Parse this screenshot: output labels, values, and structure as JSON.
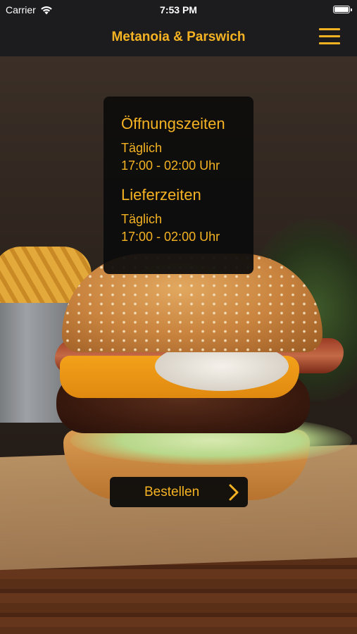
{
  "status_bar": {
    "carrier": "Carrier",
    "time": "7:53 PM",
    "wifi_icon": "wifi-icon",
    "battery_icon": "battery-icon"
  },
  "nav": {
    "title": "Metanoia & Parswich",
    "menu_icon": "hamburger-menu-icon"
  },
  "info_card": {
    "opening": {
      "heading": "Öffnungszeiten",
      "days": "Täglich",
      "hours": "17:00 - 02:00 Uhr"
    },
    "delivery": {
      "heading": "Lieferzeiten",
      "days": "Täglich",
      "hours": "17:00 - 02:00 Uhr"
    }
  },
  "order_button": {
    "label": "Bestellen",
    "icon": "chevron-right-icon"
  },
  "colors": {
    "accent": "#f5b323",
    "bar_background": "#1c1c1e",
    "card_background": "#0c0c0c"
  }
}
